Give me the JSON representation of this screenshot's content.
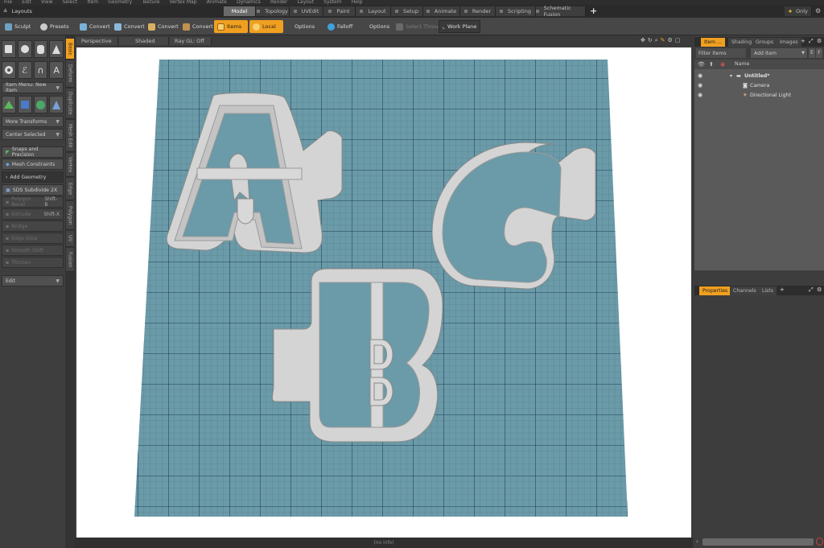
{
  "menu": [
    "File",
    "Edit",
    "View",
    "Select",
    "Item",
    "Geometry",
    "Texture",
    "Vertex Map",
    "Animate",
    "Dynamics",
    "Render",
    "Layout",
    "System",
    "Help"
  ],
  "layouts_label": "Layouts",
  "tabs": [
    "Model",
    "Topology",
    "UVEdit",
    "Paint",
    "Layout",
    "Setup",
    "Animate",
    "Render",
    "Scripting",
    "Schematic Fusion"
  ],
  "active_tab": "Model",
  "only_label": "Only",
  "toolbar": {
    "sculpt": "Sculpt",
    "presets": "Presets",
    "convert": "Convert",
    "items": "Items",
    "local": "Local",
    "options": "Options",
    "falloff": "Falloff",
    "select_through": "Select Through",
    "work_plane": "Work Plane"
  },
  "left_panel": {
    "item_menu": "Item Menu: New Item",
    "more_transforms": "More Transforms",
    "center_selected": "Center Selected",
    "snaps": "Snaps and Precision",
    "mesh_constraints": "Mesh Constraints",
    "add_geometry": "Add Geometry",
    "sds": "SDS Subdivide 2X",
    "polygon_bevel": "Polygon Bevel",
    "polygon_bevel_key": "Shift-B",
    "extrude": "Extrude",
    "extrude_key": "Shift-X",
    "bridge": "Bridge",
    "edge_slice": "Edge Slice",
    "smooth": "Smooth Shift",
    "thicken": "Thicken",
    "edit": "Edit"
  },
  "vertical_tabs": [
    "Basic",
    "Deform",
    "Duplicate",
    "Mesh Edit",
    "Vertex",
    "Edge",
    "Polygon",
    "UV",
    "Fusion"
  ],
  "viewport": {
    "view": "Perspective",
    "shading": "Shaded",
    "ray_gl": "Ray GL: Off",
    "status": "(no info)",
    "grid_color": "#6b9aa8",
    "cutter_color": "#d4d4d4"
  },
  "right_panel": {
    "tabs": [
      "Item ...",
      "Shading",
      "Groups",
      "Images"
    ],
    "filter": "Filter Items",
    "add_item": "Add Item",
    "column_name": "Name",
    "scene": "Untitled*",
    "items": [
      "Camera",
      "Directional Light"
    ],
    "bottom_tabs": [
      "Properties",
      "Channels",
      "Lists"
    ]
  }
}
